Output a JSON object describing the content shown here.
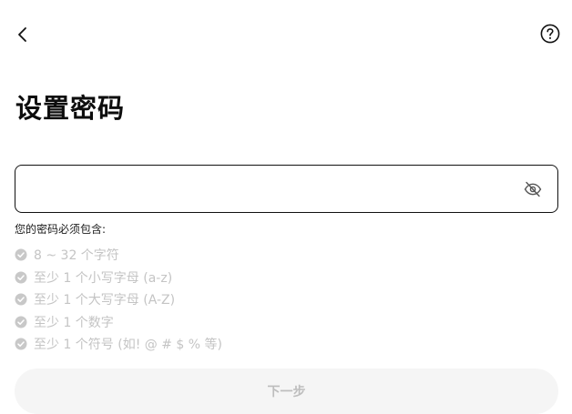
{
  "header": {
    "back_icon": "chevron-left-icon",
    "help_icon": "question-circle-icon"
  },
  "title": "设置密码",
  "password_field": {
    "value": "",
    "visibility_icon": "eye-off-icon"
  },
  "requirements": {
    "heading": "您的密码必须包含:",
    "items": [
      "8 ~ 32 个字符",
      "至少 1 个小写字母 (a-z)",
      "至少 1 个大写字母 (A-Z)",
      "至少 1 个数字",
      "至少 1 个符号 (如! @ # $ % 等)"
    ],
    "check_icon": "check-circle-icon",
    "check_color": "#c8c8c8"
  },
  "next_button": {
    "label": "下一步"
  },
  "colors": {
    "text_primary": "#111111",
    "text_disabled": "#c4c4c4",
    "button_disabled_bg": "#f5f5f5"
  }
}
